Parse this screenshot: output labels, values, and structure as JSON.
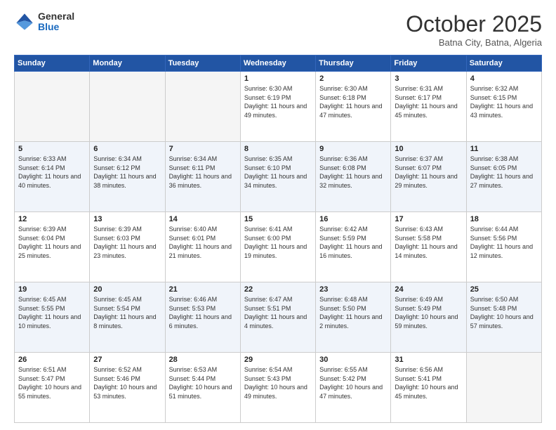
{
  "header": {
    "logo_general": "General",
    "logo_blue": "Blue",
    "month_title": "October 2025",
    "location": "Batna City, Batna, Algeria"
  },
  "weekdays": [
    "Sunday",
    "Monday",
    "Tuesday",
    "Wednesday",
    "Thursday",
    "Friday",
    "Saturday"
  ],
  "weeks": [
    [
      {
        "day": "",
        "info": ""
      },
      {
        "day": "",
        "info": ""
      },
      {
        "day": "",
        "info": ""
      },
      {
        "day": "1",
        "info": "Sunrise: 6:30 AM\nSunset: 6:19 PM\nDaylight: 11 hours\nand 49 minutes."
      },
      {
        "day": "2",
        "info": "Sunrise: 6:30 AM\nSunset: 6:18 PM\nDaylight: 11 hours\nand 47 minutes."
      },
      {
        "day": "3",
        "info": "Sunrise: 6:31 AM\nSunset: 6:17 PM\nDaylight: 11 hours\nand 45 minutes."
      },
      {
        "day": "4",
        "info": "Sunrise: 6:32 AM\nSunset: 6:15 PM\nDaylight: 11 hours\nand 43 minutes."
      }
    ],
    [
      {
        "day": "5",
        "info": "Sunrise: 6:33 AM\nSunset: 6:14 PM\nDaylight: 11 hours\nand 40 minutes."
      },
      {
        "day": "6",
        "info": "Sunrise: 6:34 AM\nSunset: 6:12 PM\nDaylight: 11 hours\nand 38 minutes."
      },
      {
        "day": "7",
        "info": "Sunrise: 6:34 AM\nSunset: 6:11 PM\nDaylight: 11 hours\nand 36 minutes."
      },
      {
        "day": "8",
        "info": "Sunrise: 6:35 AM\nSunset: 6:10 PM\nDaylight: 11 hours\nand 34 minutes."
      },
      {
        "day": "9",
        "info": "Sunrise: 6:36 AM\nSunset: 6:08 PM\nDaylight: 11 hours\nand 32 minutes."
      },
      {
        "day": "10",
        "info": "Sunrise: 6:37 AM\nSunset: 6:07 PM\nDaylight: 11 hours\nand 29 minutes."
      },
      {
        "day": "11",
        "info": "Sunrise: 6:38 AM\nSunset: 6:05 PM\nDaylight: 11 hours\nand 27 minutes."
      }
    ],
    [
      {
        "day": "12",
        "info": "Sunrise: 6:39 AM\nSunset: 6:04 PM\nDaylight: 11 hours\nand 25 minutes."
      },
      {
        "day": "13",
        "info": "Sunrise: 6:39 AM\nSunset: 6:03 PM\nDaylight: 11 hours\nand 23 minutes."
      },
      {
        "day": "14",
        "info": "Sunrise: 6:40 AM\nSunset: 6:01 PM\nDaylight: 11 hours\nand 21 minutes."
      },
      {
        "day": "15",
        "info": "Sunrise: 6:41 AM\nSunset: 6:00 PM\nDaylight: 11 hours\nand 19 minutes."
      },
      {
        "day": "16",
        "info": "Sunrise: 6:42 AM\nSunset: 5:59 PM\nDaylight: 11 hours\nand 16 minutes."
      },
      {
        "day": "17",
        "info": "Sunrise: 6:43 AM\nSunset: 5:58 PM\nDaylight: 11 hours\nand 14 minutes."
      },
      {
        "day": "18",
        "info": "Sunrise: 6:44 AM\nSunset: 5:56 PM\nDaylight: 11 hours\nand 12 minutes."
      }
    ],
    [
      {
        "day": "19",
        "info": "Sunrise: 6:45 AM\nSunset: 5:55 PM\nDaylight: 11 hours\nand 10 minutes."
      },
      {
        "day": "20",
        "info": "Sunrise: 6:45 AM\nSunset: 5:54 PM\nDaylight: 11 hours\nand 8 minutes."
      },
      {
        "day": "21",
        "info": "Sunrise: 6:46 AM\nSunset: 5:53 PM\nDaylight: 11 hours\nand 6 minutes."
      },
      {
        "day": "22",
        "info": "Sunrise: 6:47 AM\nSunset: 5:51 PM\nDaylight: 11 hours\nand 4 minutes."
      },
      {
        "day": "23",
        "info": "Sunrise: 6:48 AM\nSunset: 5:50 PM\nDaylight: 11 hours\nand 2 minutes."
      },
      {
        "day": "24",
        "info": "Sunrise: 6:49 AM\nSunset: 5:49 PM\nDaylight: 10 hours\nand 59 minutes."
      },
      {
        "day": "25",
        "info": "Sunrise: 6:50 AM\nSunset: 5:48 PM\nDaylight: 10 hours\nand 57 minutes."
      }
    ],
    [
      {
        "day": "26",
        "info": "Sunrise: 6:51 AM\nSunset: 5:47 PM\nDaylight: 10 hours\nand 55 minutes."
      },
      {
        "day": "27",
        "info": "Sunrise: 6:52 AM\nSunset: 5:46 PM\nDaylight: 10 hours\nand 53 minutes."
      },
      {
        "day": "28",
        "info": "Sunrise: 6:53 AM\nSunset: 5:44 PM\nDaylight: 10 hours\nand 51 minutes."
      },
      {
        "day": "29",
        "info": "Sunrise: 6:54 AM\nSunset: 5:43 PM\nDaylight: 10 hours\nand 49 minutes."
      },
      {
        "day": "30",
        "info": "Sunrise: 6:55 AM\nSunset: 5:42 PM\nDaylight: 10 hours\nand 47 minutes."
      },
      {
        "day": "31",
        "info": "Sunrise: 6:56 AM\nSunset: 5:41 PM\nDaylight: 10 hours\nand 45 minutes."
      },
      {
        "day": "",
        "info": ""
      }
    ]
  ]
}
